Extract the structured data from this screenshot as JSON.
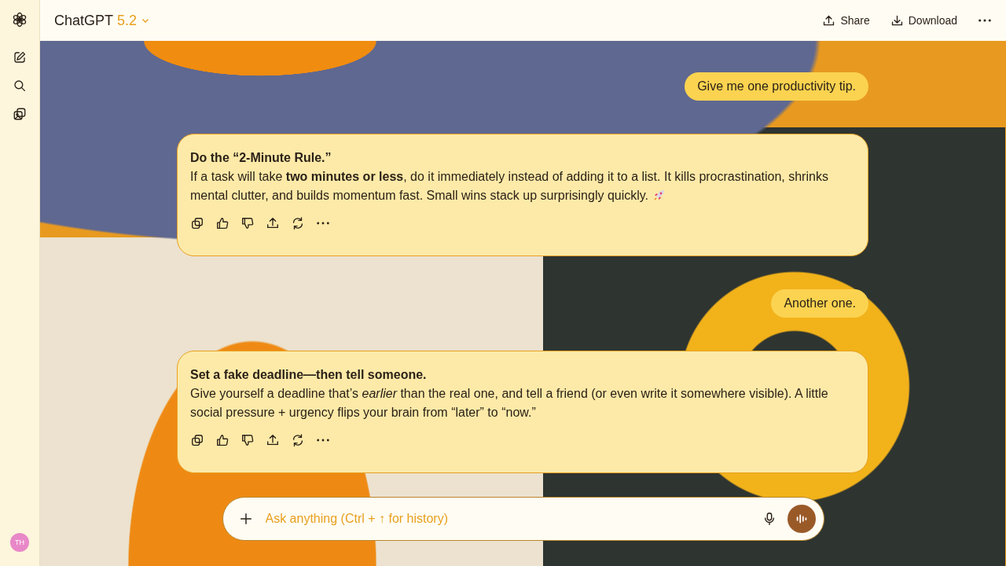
{
  "header": {
    "title": "ChatGPT",
    "version": "5.2",
    "actions": [
      {
        "kind": "share",
        "label": "Share"
      },
      {
        "kind": "download",
        "label": "Download"
      }
    ]
  },
  "sidebar": {
    "avatar": "TH"
  },
  "messages": [
    {
      "kind": "user",
      "text": "Give me one productivity tip."
    },
    {
      "kind": "assistant",
      "title": "Do the “2-Minute Rule.”",
      "body": "If a task will take **two minutes or less**, do it immediately instead of adding it to a list. It kills procrastination, shrinks mental clutter, and builds momentum fast. Small wins stack up surprisingly quickly.",
      "rocket": true
    },
    {
      "kind": "user",
      "text": "Another one."
    },
    {
      "kind": "assistant",
      "title": "Set a fake deadline—then tell someone.",
      "body": "Give yourself a deadline that’s *earlier* than the real one, and tell a friend (or even write it somewhere visible). A little social pressure + urgency flips your brain from “later” to “now.”",
      "rocket": false
    }
  ],
  "composer": {
    "placeholder": "Ask anything (Ctrl + ↑ for history)"
  }
}
